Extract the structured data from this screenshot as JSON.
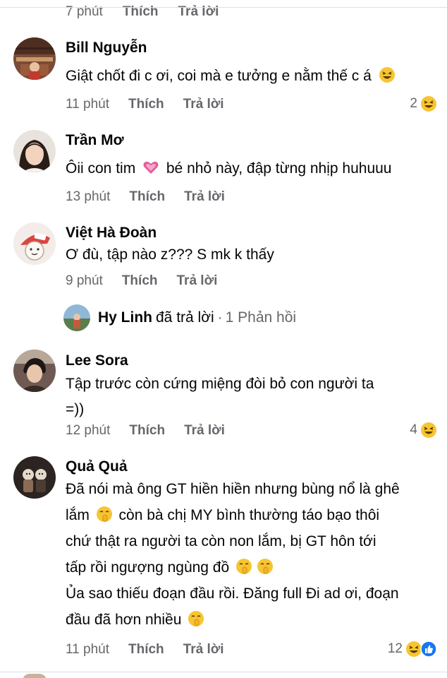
{
  "top_partial": {
    "time": "7 phút",
    "like_label": "Thích",
    "reply_label": "Trả lời"
  },
  "comments": [
    {
      "author": "Bill Nguyễn",
      "text": "Giật chốt đi c ơi,  coi mà e tưởng e nằm thế c á",
      "time": "11 phút",
      "like_label": "Thích",
      "reply_label": "Trả lời",
      "reaction_count": "2",
      "reaction_icon": "laughing-emoji"
    },
    {
      "author": "Trần Mơ",
      "text_before": "Ôii con tim",
      "text_after": "bé nhỏ này, đập từng nhịp huhuuu",
      "inline_icon": "pink-heart-emoji",
      "time": "13 phút",
      "like_label": "Thích",
      "reply_label": "Trả lời"
    },
    {
      "author": "Việt Hà Đoàn",
      "text": "Ơ đù, tập nào z??? S mk k thấy",
      "time": "9 phút",
      "like_label": "Thích",
      "reply_label": "Trả lời",
      "reply_summary": {
        "name": "Hy Linh",
        "action": "đã trả lời",
        "separator": "·",
        "count": "1 Phản hồi"
      }
    },
    {
      "author": "Lee Sora",
      "line1": "Tập trước còn cứng miệng  đòi bỏ con người ta",
      "line2": "=))",
      "time": "12 phút",
      "like_label": "Thích",
      "reply_label": "Trả lời",
      "reaction_count": "4",
      "reaction_icon": "laughing-emoji"
    },
    {
      "author": "Quả Quả",
      "line1": "Đã nói mà ông GT hiền hiền nhưng bùng nổ là ghê",
      "line2_a": "lắm",
      "line2_b": "còn bà chị MY bình thường táo bạo thôi",
      "line3": "chứ thật ra người ta còn non lắm, bị GT hôn tới",
      "line4": "tấp rồi ngượng ngùng đồ",
      "line5": "Ủa sao thiếu đoạn đầu rồi. Đăng full Đi ad ơi, đoạn",
      "line6": "đầu đã hơn nhiều",
      "inline_icon": "shushing-face-emoji",
      "time": "11 phút",
      "like_label": "Thích",
      "reply_label": "Trả lời",
      "reaction_count": "12",
      "reaction_icons": [
        "laughing-emoji",
        "like-thumb-icon"
      ]
    }
  ],
  "colors": {
    "secondary_text": "#65676b",
    "primary_text": "#050505",
    "like_blue": "#1877f2",
    "emoji_yellow": "#f7c531",
    "heart_pink": "#e45c9c"
  }
}
